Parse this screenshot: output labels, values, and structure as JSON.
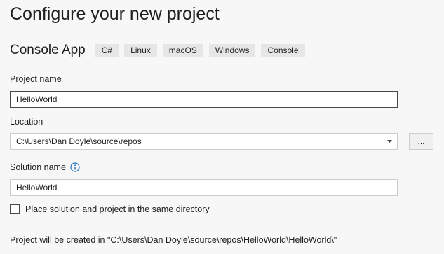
{
  "page": {
    "title": "Configure your new project"
  },
  "template": {
    "name": "Console App",
    "tags": [
      "C#",
      "Linux",
      "macOS",
      "Windows",
      "Console"
    ]
  },
  "project_name": {
    "label": "Project name",
    "value": "HelloWorld"
  },
  "location": {
    "label": "Location",
    "value": "C:\\Users\\Dan Doyle\\source\\repos",
    "browse_label": "...",
    "dropdown_icon": "chevron-down-icon"
  },
  "solution_name": {
    "label": "Solution name",
    "value": "HelloWorld",
    "info_icon": "info-icon"
  },
  "same_directory": {
    "label": "Place solution and project in the same directory",
    "checked": false
  },
  "summary": {
    "text": "Project will be created in \"C:\\Users\\Dan Doyle\\source\\repos\\HelloWorld\\HelloWorld\\\""
  },
  "colors": {
    "background": "#f7f7f7",
    "tag_background": "#e6e6e6",
    "input_border_focused": "#464646",
    "input_border": "#cccccc",
    "info_icon": "#1e6fc0"
  }
}
